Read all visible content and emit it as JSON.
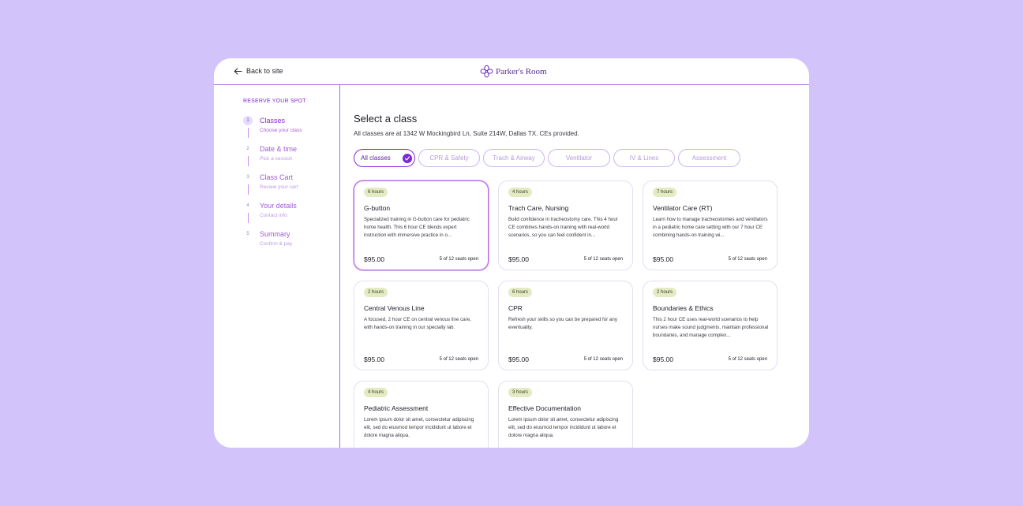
{
  "header": {
    "back_label": "Back to site",
    "brand_name": "Parker's Room"
  },
  "sidebar": {
    "title": "RESERVE YOUR SPOT",
    "steps": [
      {
        "num": "1",
        "title": "Classes",
        "sub": "Choose your class"
      },
      {
        "num": "2",
        "title": "Date & time",
        "sub": "Pick a session"
      },
      {
        "num": "3",
        "title": "Class Cart",
        "sub": "Review your cart"
      },
      {
        "num": "4",
        "title": "Your details",
        "sub": "Contact info"
      },
      {
        "num": "5",
        "title": "Summary",
        "sub": "Confirm & pay"
      }
    ]
  },
  "main": {
    "title": "Select a class",
    "subtitle": "All classes are at 1342 W Mockingbird Ln, Suite 214W, Dallas TX. CEs provided.",
    "filters": [
      "All classes",
      "CPR & Safety",
      "Trach & Airway",
      "Ventilator",
      "IV & Lines",
      "Assessment"
    ],
    "cards": [
      {
        "badge": "6 hours",
        "title": "G-button",
        "desc": "Specialized training in G-button care for pediatric home health. This 6 hour CE blends expert instruction with immersive practice in o...",
        "price": "$95.00",
        "seats": "5 of 12 seats open"
      },
      {
        "badge": "4 hours",
        "title": "Trach Care, Nursing",
        "desc": "Build confidence in tracheostomy care. This 4 hour CE combines hands-on training with real-world scenarios, so you can feel confident in...",
        "price": "$95.00",
        "seats": "5 of 12 seats open"
      },
      {
        "badge": "7 hours",
        "title": "Ventilator Care (RT)",
        "desc": "Learn how to manage tracheostomies and ventilators in a pediatric home care setting with our 7 hour CE combining hands-on training wi...",
        "price": "$95.00",
        "seats": "5 of 12 seats open"
      },
      {
        "badge": "2 hours",
        "title": "Central Venous Line",
        "desc": "A focused, 2 hour CE on central venous line care, with hands-on training in our specialty lab.",
        "price": "$95.00",
        "seats": "5 of 12 seats open"
      },
      {
        "badge": "6 hours",
        "title": "CPR",
        "desc": "Refresh your skills so you can be prepared for any eventuality.",
        "price": "$95.00",
        "seats": "5 of 12 seats open"
      },
      {
        "badge": "2 hours",
        "title": "Boundaries & Ethics",
        "desc": "This 2 hour CE uses real-world scenarios to help nurses make sound judgments, maintain professional boundaries, and manage complex...",
        "price": "$95.00",
        "seats": "5 of 12 seats open"
      },
      {
        "badge": "4 hours",
        "title": "Pediatric Assessment",
        "desc": "Lorem ipsum dolor sit amet, consectetur adipiscing elit, sed do eiusmod tempor incididunt ut labore et dolore magna aliqua.",
        "price": "",
        "seats": ""
      },
      {
        "badge": "3 hours",
        "title": "Effective Documentation",
        "desc": "Lorem ipsum dolor sit amet, consectetur adipiscing elit, sed do eiusmod tempor incididunt ut labore et dolore magna aliqua.",
        "price": "",
        "seats": ""
      }
    ]
  },
  "colors": {
    "accent": "#8a2ad0",
    "badge_bg": "#e3ebc3",
    "page_bg": "#d2c4fb"
  }
}
